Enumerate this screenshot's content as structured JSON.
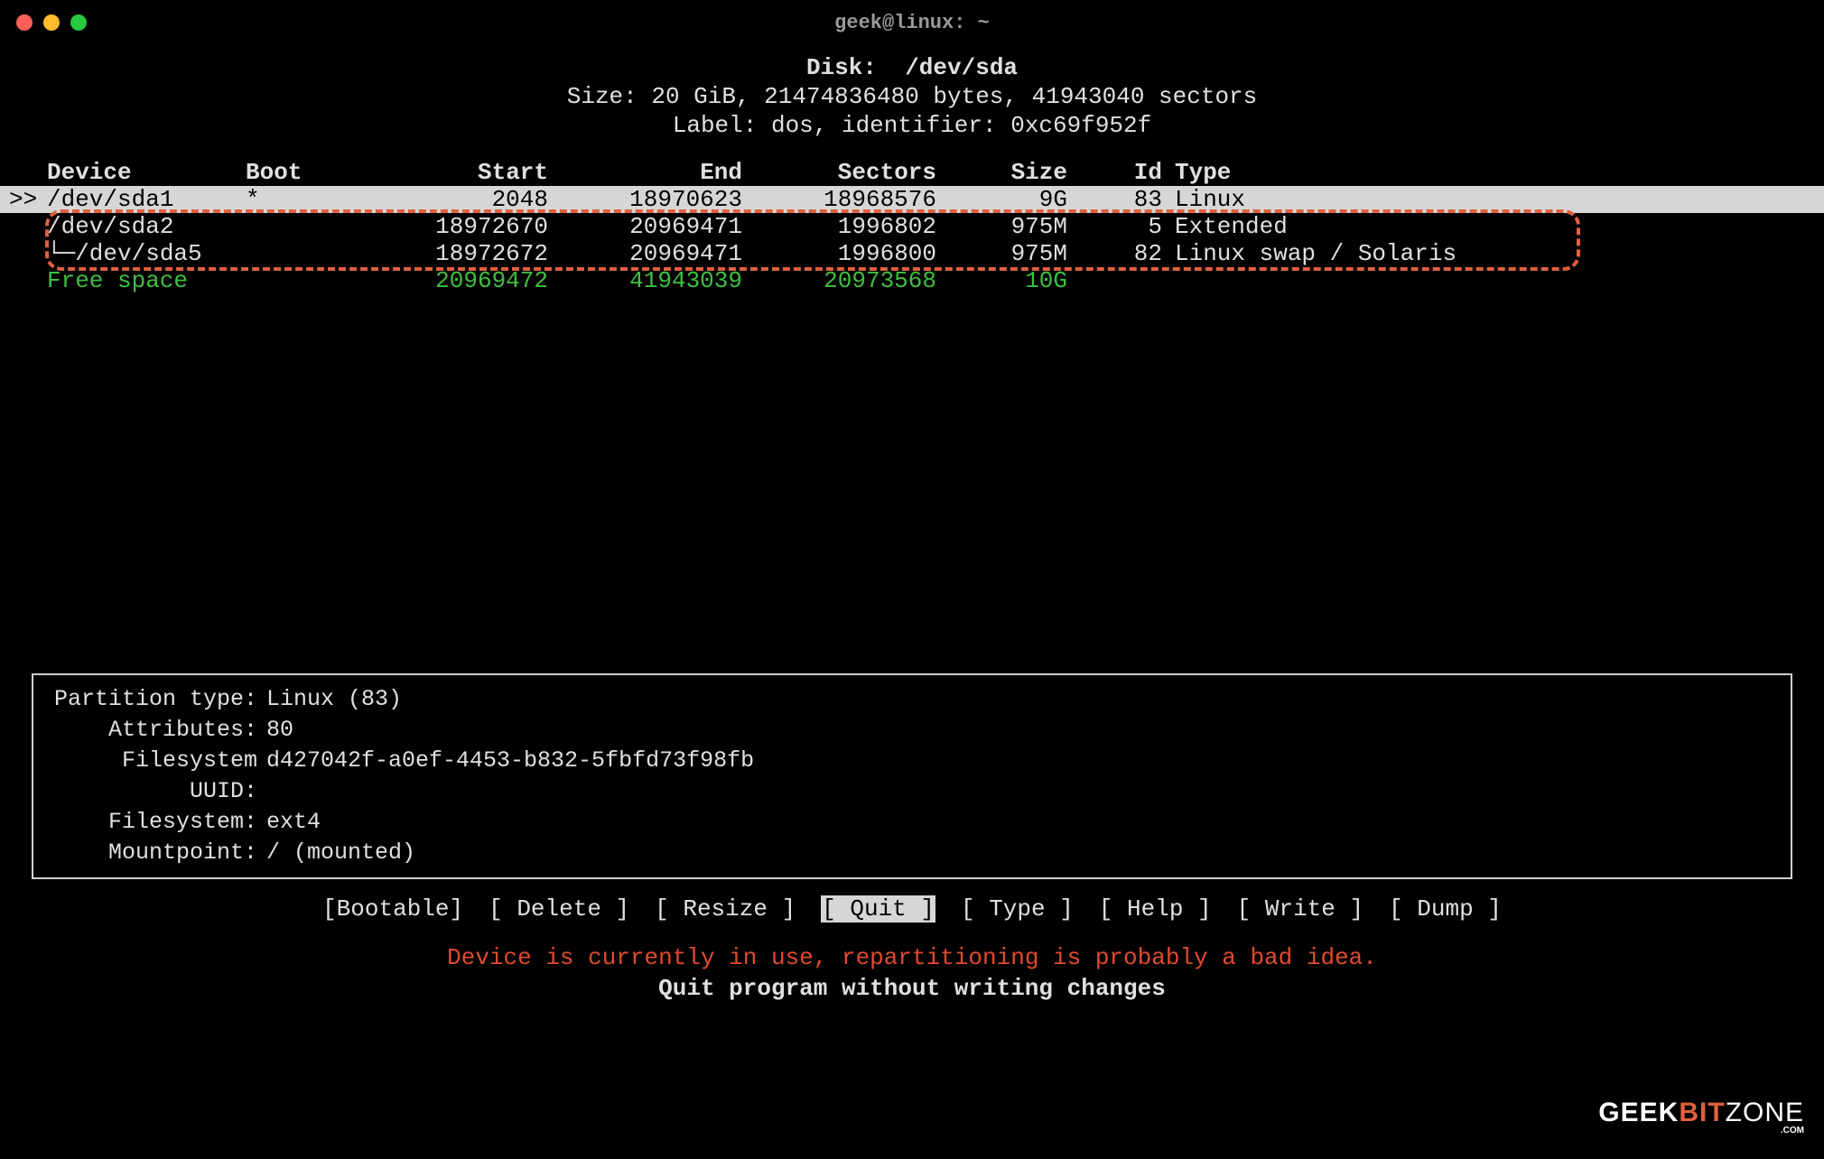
{
  "window": {
    "title": "geek@linux: ~"
  },
  "header": {
    "disk_label": "Disk:",
    "disk_path": "/dev/sda",
    "size_line": "Size: 20 GiB, 21474836480 bytes, 41943040 sectors",
    "label_line": "Label: dos, identifier: 0xc69f952f"
  },
  "columns": {
    "device": "Device",
    "boot": "Boot",
    "start": "Start",
    "end": "End",
    "sectors": "Sectors",
    "size": "Size",
    "id": "Id",
    "type": "Type"
  },
  "rows": [
    {
      "cursor": ">>",
      "device": "/dev/sda1",
      "boot": "*",
      "start": "2048",
      "end": "18970623",
      "sectors": "18968576",
      "size": "9G",
      "id": "83",
      "type": "Linux",
      "selected": true,
      "class": "selected"
    },
    {
      "cursor": "",
      "device": "/dev/sda2",
      "boot": "",
      "start": "18972670",
      "end": "20969471",
      "sectors": "1996802",
      "size": "975M",
      "id": "5",
      "type": "Extended",
      "class": ""
    },
    {
      "cursor": "",
      "device": "└─/dev/sda5",
      "boot": "",
      "start": "18972672",
      "end": "20969471",
      "sectors": "1996800",
      "size": "975M",
      "id": "82",
      "type": "Linux swap / Solaris",
      "class": ""
    },
    {
      "cursor": "",
      "device": "Free space",
      "boot": "",
      "start": "20969472",
      "end": "41943039",
      "sectors": "20973568",
      "size": "10G",
      "id": "",
      "type": "",
      "class": "free"
    }
  ],
  "info": {
    "partition_type_label": "Partition type:",
    "partition_type": "Linux (83)",
    "attributes_label": "Attributes:",
    "attributes": "80",
    "fsuuid_label": "Filesystem UUID:",
    "fsuuid": "d427042f-a0ef-4453-b832-5fbfd73f98fb",
    "filesystem_label": "Filesystem:",
    "filesystem": "ext4",
    "mountpoint_label": "Mountpoint:",
    "mountpoint": "/ (mounted)"
  },
  "menu": {
    "items": [
      {
        "text": "[Bootable]",
        "name": "menu-bootable"
      },
      {
        "text": "[ Delete ]",
        "name": "menu-delete"
      },
      {
        "text": "[ Resize ]",
        "name": "menu-resize"
      },
      {
        "text": "[  Quit  ]",
        "name": "menu-quit",
        "selected": true
      },
      {
        "text": "[  Type  ]",
        "name": "menu-type"
      },
      {
        "text": "[  Help  ]",
        "name": "menu-help"
      },
      {
        "text": "[  Write ]",
        "name": "menu-write"
      },
      {
        "text": "[  Dump  ]",
        "name": "menu-dump"
      }
    ]
  },
  "messages": {
    "warning": "Device is currently in use, repartitioning is probably a bad idea.",
    "hint": "Quit program without writing changes"
  },
  "watermark": {
    "a": "GEEK",
    "b": "BIT",
    "c": "ZONE",
    "d": ".COM"
  }
}
